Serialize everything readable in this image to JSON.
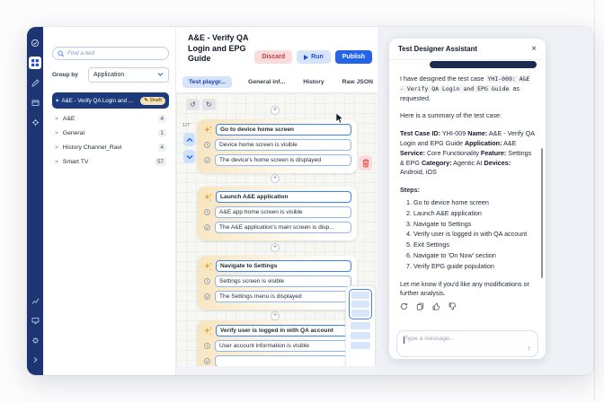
{
  "colors": {
    "sidebar_navy": "#1d3572",
    "accent_blue": "#2563eb",
    "selected_navy": "#1d3b7c",
    "draft_badge_bg": "#f4e3ba",
    "card_gradient_start": "#f7e4bc",
    "discard_bg": "#fbdcdc",
    "discard_text": "#d03939",
    "run_bg": "#d6e4fb",
    "publish_bg": "#2563eb",
    "user_bubble": "#1c2c50"
  },
  "icons": {
    "rail": [
      "app-logo",
      "dashboard",
      "pencil",
      "package",
      "settings",
      "analytics",
      "devices",
      "preferences",
      "collapse-arrow"
    ],
    "chat_actions": [
      "regenerate",
      "copy",
      "thumbs-up",
      "thumbs-down"
    ]
  },
  "left_panel": {
    "search_placeholder": "Find a test",
    "group_by_label": "Group by",
    "group_by_value": "Application",
    "selected_test": {
      "label": "A&E - Verify QA Login and ...",
      "badge": "Draft",
      "badge_icon": "✎"
    },
    "groups": [
      {
        "label": "A&E",
        "count": "4"
      },
      {
        "label": "General",
        "count": "1"
      },
      {
        "label": "History Channel_Ravi",
        "count": "4"
      },
      {
        "label": "Smart TV",
        "count": "57"
      }
    ]
  },
  "editor": {
    "title": "A&E - Verify QA Login and EPG Guide",
    "buttons": {
      "discard": "Discard",
      "run": "Run",
      "publish": "Publish"
    },
    "tabs": [
      "Test playgr...",
      "General inf...",
      "History",
      "Raw JSON"
    ],
    "pagination": "1/7",
    "undo_glyph": "↺",
    "redo_glyph": "↻",
    "plus_glyph": "+",
    "steps": [
      {
        "action": "Go to device home screen",
        "condition": "Device home screen is visible",
        "expected": "The device's home screen is displayed"
      },
      {
        "action": "Launch A&E application",
        "condition": "A&E app home screen is visible",
        "expected": "The A&E application's main screen is disp..."
      },
      {
        "action": "Navigate to Settings",
        "condition": "Settings screen is visible",
        "expected": "The Settings menu is displayed"
      },
      {
        "action": "Verify user is logged in with QA account",
        "condition": "User account information is visible",
        "expected": ""
      }
    ]
  },
  "assistant": {
    "title": "Test Designer Assistant",
    "close_glyph": "×",
    "intro_prefix": "I have designed the test case",
    "intro_code": "YHI-009: A&E - Verify QA Login and EPG Guide",
    "intro_suffix": "as requested.",
    "summary_heading": "Here is a summary of the test case:",
    "summary": [
      {
        "label": "Test Case ID:",
        "value": "YHI-009"
      },
      {
        "label": "Name:",
        "value": "A&E - Verify QA Login and EPG Guide"
      },
      {
        "label": "Application:",
        "value": "A&E"
      },
      {
        "label": "Service:",
        "value": "Core Functionality"
      },
      {
        "label": "Feature:",
        "value": "Settings & EPG"
      },
      {
        "label": "Category:",
        "value": "Agentic AI"
      },
      {
        "label": "Devices:",
        "value": "Android, iOS"
      }
    ],
    "steps_heading": "Steps:",
    "steps": [
      "Go to device home screen",
      "Launch A&E application",
      "Navigate to Settings",
      "Verify user is logged in with QA account",
      "Exit Settings",
      "Navigate to 'On Now' section",
      "Verify EPG guide population"
    ],
    "outro": "Let me know if you'd like any modifications or further analysis.",
    "input_placeholder": "Type a message...",
    "send_glyph": "↑"
  }
}
